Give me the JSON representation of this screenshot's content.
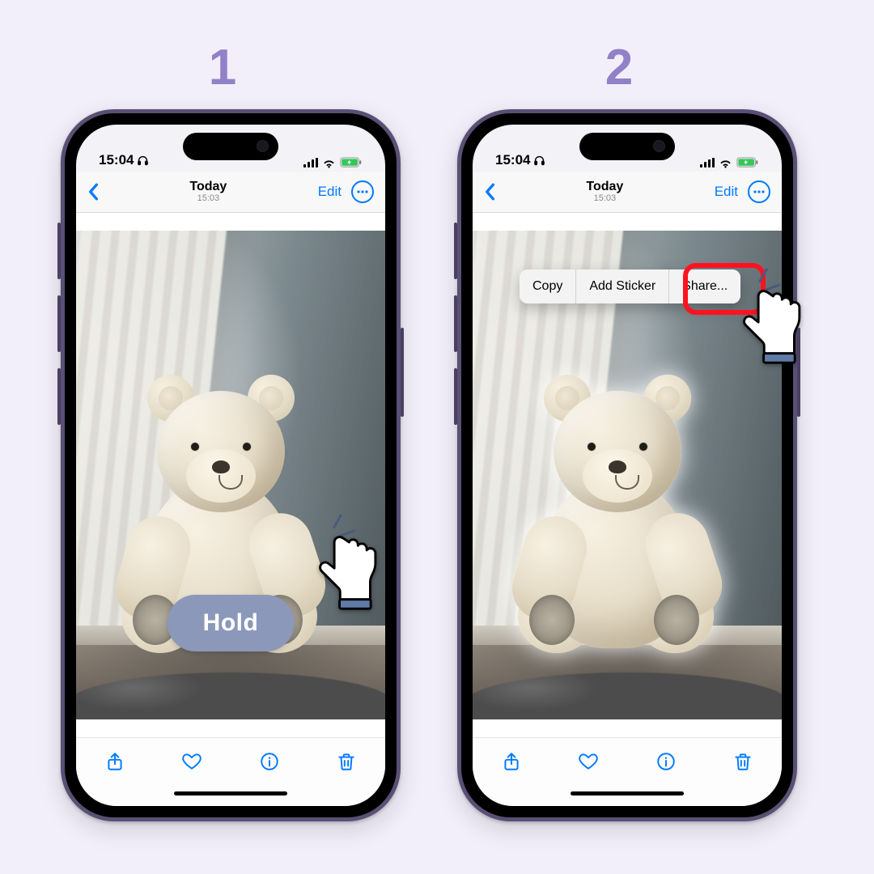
{
  "steps": {
    "one": "1",
    "two": "2"
  },
  "status": {
    "time": "15:04"
  },
  "nav": {
    "title": "Today",
    "subtitle": "15:03",
    "edit": "Edit"
  },
  "annotation": {
    "hold": "Hold"
  },
  "context_menu": {
    "copy": "Copy",
    "add_sticker": "Add Sticker",
    "share": "Share..."
  },
  "icons": {
    "back": "chevron-left",
    "more": "ellipsis-circle",
    "share": "square-arrow-up",
    "heart": "heart",
    "info": "info-circle",
    "trash": "trash",
    "headphones": "headphones",
    "wifi": "wifi",
    "battery": "battery-charging"
  },
  "colors": {
    "accent": "#9181c8",
    "ios_blue": "#007aff",
    "pill": "#8b98b9",
    "highlight": "#ff1220"
  }
}
